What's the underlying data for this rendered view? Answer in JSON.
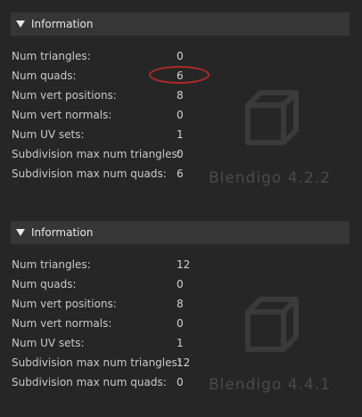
{
  "panels": [
    {
      "header": "Information",
      "rows": [
        {
          "label": "Num triangles:",
          "value": "0"
        },
        {
          "label": "Num quads:",
          "value": "6"
        },
        {
          "label": "Num vert positions:",
          "value": "8"
        },
        {
          "label": "Num vert normals:",
          "value": "0"
        },
        {
          "label": "Num UV sets:",
          "value": "1"
        },
        {
          "label": "Subdivision max num triangles:",
          "value": "0"
        },
        {
          "label": "Subdivision max num quads:",
          "value": "6"
        }
      ],
      "watermark": "Blendigo 4.2.2"
    },
    {
      "header": "Information",
      "rows": [
        {
          "label": "Num triangles:",
          "value": "12"
        },
        {
          "label": "Num quads:",
          "value": "0"
        },
        {
          "label": "Num vert positions:",
          "value": "8"
        },
        {
          "label": "Num vert normals:",
          "value": "0"
        },
        {
          "label": "Num UV sets:",
          "value": "1"
        },
        {
          "label": "Subdivision max num triangles:",
          "value": "12"
        },
        {
          "label": "Subdivision max num quads:",
          "value": "0"
        }
      ],
      "watermark": "Blendigo 4.4.1"
    }
  ],
  "colors": {
    "background": "#262626",
    "header_bg": "#363636",
    "annotation": "#b02a2a"
  }
}
